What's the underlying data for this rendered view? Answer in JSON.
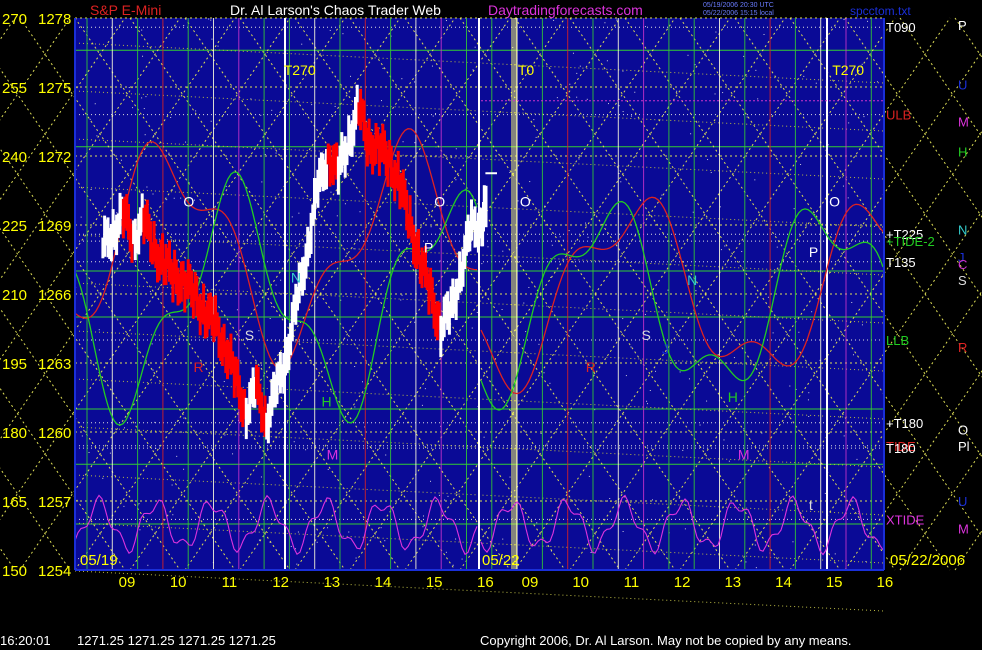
{
  "header": {
    "chart_name": "S&P E-Mini",
    "author": "Dr. Al Larson's Chaos Trader Web",
    "site": "Daytradingforecasts.com",
    "stamp_line1": "05/19/2006 20:30 UTC",
    "stamp_line2": "05/22/2006 15:15 local",
    "file": "spcctom.txt"
  },
  "footer": {
    "clock": "16:20:01",
    "quote": "1271.25 1271.25 1271.25 1271.25",
    "copyright": "Copyright 2006, Dr. Al Larson. May not be copied by any means."
  },
  "colors": {
    "background": "#000000",
    "plot_bg": "#0a0a96",
    "price_up": "#ffffff",
    "price_down": "#ff0000",
    "tide": "#dd2222",
    "flux_green": "#22cc22",
    "xtide": "#dd33dd",
    "yellow_label": "#ffff00",
    "grid_yellow": "#dddd55",
    "vline_green": "#33cc33",
    "vline_white": "#ffffdd"
  },
  "chart_data": {
    "type": "line",
    "title": "S&P E-Mini",
    "y_left_angles": [
      "270",
      "255",
      "240",
      "225",
      "210",
      "195",
      "180",
      "165",
      "150"
    ],
    "y_left_prices": [
      "1278",
      "1275",
      "1272",
      "1269",
      "1266",
      "1263",
      "1260",
      "1257",
      "1254"
    ],
    "ylim": [
      1254,
      1278
    ],
    "x_hours_day1": [
      "09",
      "10",
      "11",
      "12",
      "13",
      "14",
      "15",
      "16"
    ],
    "x_hours_day2": [
      "09",
      "10",
      "11",
      "12",
      "13",
      "14",
      "15",
      "16"
    ],
    "day1_label": "05/19",
    "day2_label": "05/22",
    "date_right": "05/22/2006",
    "session_markers": [
      {
        "label": "T270",
        "day": 1,
        "hour": 12.1
      },
      {
        "label": "T0",
        "day": 2,
        "hour": 8.8
      },
      {
        "label": "T270",
        "day": 2,
        "hour": 15.0
      }
    ],
    "right_labels": [
      {
        "text": "T090",
        "price": 1277.6,
        "color": "#ffffff"
      },
      {
        "text": "ULB",
        "price": 1273.8,
        "color": "#dd2222"
      },
      {
        "text": "+T225",
        "price": 1268.6,
        "color": "#ffffff"
      },
      {
        "text": "+TIDE-2",
        "price": 1268.3,
        "color": "#22cc22"
      },
      {
        "text": "T135",
        "price": 1267.4,
        "color": "#ffffff"
      },
      {
        "text": "LLB",
        "price": 1264.0,
        "color": "#22cc22"
      },
      {
        "text": "+T180",
        "price": 1260.4,
        "color": "#ffffff"
      },
      {
        "text": "TIDE",
        "price": 1259.4,
        "color": "#dd2222"
      },
      {
        "text": "T180",
        "price": 1259.3,
        "color": "#ffffff"
      },
      {
        "text": "XTIDE",
        "price": 1256.2,
        "color": "#dd33dd"
      }
    ],
    "far_right_letters": [
      {
        "text": "P",
        "price": 1277.7,
        "color": "#ffffff"
      },
      {
        "text": "U",
        "price": 1275.1,
        "color": "#1a2fd8"
      },
      {
        "text": "M",
        "price": 1273.5,
        "color": "#dd33dd"
      },
      {
        "text": "H",
        "price": 1272.2,
        "color": "#22cc22"
      },
      {
        "text": "N",
        "price": 1268.8,
        "color": "#33cccc"
      },
      {
        "text": "J",
        "price": 1267.6,
        "color": "#1a2fd8"
      },
      {
        "text": "C",
        "price": 1267.3,
        "color": "#cc33cc"
      },
      {
        "text": "S",
        "price": 1266.6,
        "color": "#dddddd"
      },
      {
        "text": "R",
        "price": 1263.7,
        "color": "#dd2222"
      },
      {
        "text": "O",
        "price": 1260.1,
        "color": "#ffffff"
      },
      {
        "text": "Pl",
        "price": 1259.4,
        "color": "#ffffff"
      },
      {
        "text": "U",
        "price": 1257.0,
        "color": "#1a2fd8"
      },
      {
        "text": "M",
        "price": 1255.8,
        "color": "#dd33dd"
      }
    ],
    "planet_letters": [
      {
        "text": "O",
        "day": 1,
        "hour": 10.1,
        "price": 1269.8,
        "color": "#ffffff"
      },
      {
        "text": "O",
        "day": 1,
        "hour": 15.0,
        "price": 1269.8,
        "color": "#ffffff"
      },
      {
        "text": "N",
        "day": 1,
        "hour": 12.2,
        "price": 1266.5,
        "color": "#33cccc"
      },
      {
        "text": "S",
        "day": 1,
        "hour": 11.3,
        "price": 1264.0,
        "color": "#dddddd"
      },
      {
        "text": "R",
        "day": 1,
        "hour": 10.3,
        "price": 1262.6,
        "color": "#dd2222"
      },
      {
        "text": "H",
        "day": 1,
        "hour": 12.8,
        "price": 1261.1,
        "color": "#22cc22"
      },
      {
        "text": "M",
        "day": 1,
        "hour": 12.9,
        "price": 1258.8,
        "color": "#dd33dd"
      },
      {
        "text": "P",
        "day": 1,
        "hour": 14.8,
        "price": 1267.8,
        "color": "#ffffff"
      },
      {
        "text": "O",
        "day": 2,
        "hour": 8.8,
        "price": 1269.8,
        "color": "#ffffff"
      },
      {
        "text": "N",
        "day": 2,
        "hour": 12.1,
        "price": 1266.4,
        "color": "#33cccc"
      },
      {
        "text": "S",
        "day": 2,
        "hour": 11.2,
        "price": 1264.0,
        "color": "#dddddd"
      },
      {
        "text": "J",
        "day": 2,
        "hour": 11.6,
        "price": 1263.4,
        "color": "#1a2fd8"
      },
      {
        "text": "R",
        "day": 2,
        "hour": 10.1,
        "price": 1262.6,
        "color": "#dd2222"
      },
      {
        "text": "H",
        "day": 2,
        "hour": 12.9,
        "price": 1261.3,
        "color": "#22cc22"
      },
      {
        "text": "M",
        "day": 2,
        "hour": 13.1,
        "price": 1258.8,
        "color": "#dd33dd"
      },
      {
        "text": "P",
        "day": 2,
        "hour": 14.5,
        "price": 1267.6,
        "color": "#ffffff"
      },
      {
        "text": "O",
        "day": 2,
        "hour": 14.9,
        "price": 1269.8,
        "color": "#ffffff"
      },
      {
        "text": "t",
        "day": 2,
        "hour": 14.5,
        "price": 1256.6,
        "color": "#dddddd"
      }
    ],
    "price_series": {
      "day": 1,
      "hours": [
        8.5,
        8.7,
        8.9,
        9.1,
        9.3,
        9.5,
        9.7,
        9.9,
        10.1,
        10.3,
        10.5,
        10.7,
        10.9,
        11.1,
        11.3,
        11.5,
        11.7,
        11.9,
        12.1,
        12.3,
        12.5,
        12.7,
        12.9,
        13.1,
        13.3,
        13.5,
        13.7,
        13.9,
        14.1,
        14.3,
        14.5,
        14.7,
        14.9,
        15.1,
        15.3,
        15.5,
        15.7,
        15.9,
        16.0
      ],
      "prices": [
        1268.0,
        1268.8,
        1269.4,
        1268.5,
        1269.2,
        1268.0,
        1267.3,
        1266.8,
        1266.5,
        1265.9,
        1265.2,
        1264.6,
        1263.7,
        1262.2,
        1261.0,
        1261.8,
        1260.6,
        1261.8,
        1263.6,
        1265.6,
        1268.2,
        1270.5,
        1272.1,
        1271.2,
        1272.8,
        1274.0,
        1272.6,
        1272.3,
        1271.8,
        1270.8,
        1269.0,
        1267.5,
        1266.0,
        1264.6,
        1265.2,
        1267.2,
        1268.8,
        1269.2,
        1269.8
      ]
    },
    "last_price": 1271.25
  }
}
